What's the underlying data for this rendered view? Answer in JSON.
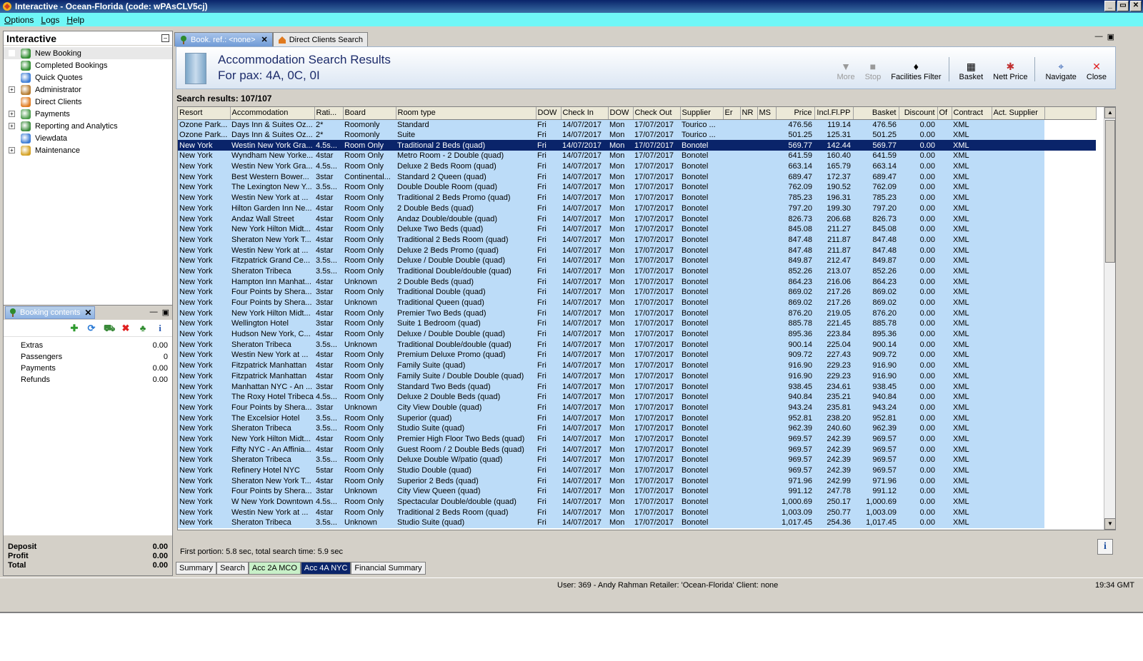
{
  "window": {
    "title": "Interactive - Ocean-Florida (code: wPAsCLV5cj)",
    "buttons": [
      "_",
      "▭",
      "✕"
    ]
  },
  "menu": [
    "Options",
    "Logs",
    "Help"
  ],
  "nav": {
    "title": "Interactive",
    "items": [
      {
        "label": "New Booking",
        "expander": "",
        "icon": "palm-tree-icon",
        "color": "#2e8b2e"
      },
      {
        "label": "Completed Bookings",
        "expander": "",
        "icon": "palm-tree-icon",
        "color": "#2e8b2e"
      },
      {
        "label": "Quick Quotes",
        "expander": "",
        "icon": "globe-icon",
        "color": "#3a7bd5"
      },
      {
        "label": "Administrator",
        "expander": "+",
        "icon": "person-icon",
        "color": "#b57a2e"
      },
      {
        "label": "Direct Clients",
        "expander": "",
        "icon": "house-icon",
        "color": "#e07a1e"
      },
      {
        "label": "Payments",
        "expander": "+",
        "icon": "payments-icon",
        "color": "#4a9a4a"
      },
      {
        "label": "Reporting and Analytics",
        "expander": "+",
        "icon": "report-icon",
        "color": "#3a8a3a"
      },
      {
        "label": "Viewdata",
        "expander": "",
        "icon": "globe-icon",
        "color": "#3a7bd5"
      },
      {
        "label": "Maintenance",
        "expander": "+",
        "icon": "toolbox-icon",
        "color": "#d4a020"
      }
    ]
  },
  "booking": {
    "tab_label": "Booking contents",
    "rows": [
      {
        "label": "Extras",
        "value": "0.00"
      },
      {
        "label": "Passengers",
        "value": "0"
      },
      {
        "label": "Payments",
        "value": "0.00"
      },
      {
        "label": "Refunds",
        "value": "0.00"
      }
    ],
    "totals": [
      {
        "label": "Deposit",
        "value": "0.00"
      },
      {
        "label": "Profit",
        "value": "0.00"
      },
      {
        "label": "Total",
        "value": "0.00"
      }
    ]
  },
  "tabs": [
    {
      "label": "Book. ref.: <none>",
      "active": true
    },
    {
      "label": "Direct Clients Search",
      "active": false
    }
  ],
  "search": {
    "title": "Accommodation Search Results",
    "subtitle": "For pax: 4A, 0C, 0I",
    "tools": [
      {
        "label": "More",
        "icon": "more-icon",
        "glyph": "▼",
        "disabled": true
      },
      {
        "label": "Stop",
        "icon": "stop-icon",
        "glyph": "■",
        "disabled": true
      },
      {
        "label": "Facilities Filter",
        "icon": "filter-icon",
        "glyph": "♦",
        "disabled": false
      },
      {
        "label": "Basket",
        "icon": "basket-icon",
        "glyph": "▦",
        "disabled": false
      },
      {
        "label": "Nett Price",
        "icon": "nett-price-icon",
        "glyph": "✱",
        "disabled": false
      },
      {
        "label": "Navigate",
        "icon": "navigate-icon",
        "glyph": "⌖",
        "disabled": false
      },
      {
        "label": "Close",
        "icon": "close-icon",
        "glyph": "✕",
        "disabled": false
      }
    ],
    "results_label": "Search results: 107/107",
    "timing": "First portion: 5.8 sec, total search time: 5.9 sec"
  },
  "table": {
    "columns": [
      "Resort",
      "Accommodation",
      "Rati...",
      "Board",
      "Room type",
      "DOW",
      "Check In",
      "DOW",
      "Check Out",
      "Supplier",
      "Er",
      "NR",
      "MS",
      "Price",
      "Incl.Fl.PP",
      "Basket",
      "Discount",
      "Of",
      "Contract",
      "Act. Supplier"
    ],
    "rows": [
      [
        "Ozone Park...",
        "Days Inn & Suites Oz...",
        "2*",
        "Roomonly",
        "Standard",
        "Fri",
        "14/07/2017",
        "Mon",
        "17/07/2017",
        "Tourico ...",
        "",
        "",
        "",
        "476.56",
        "119.14",
        "476.56",
        "0.00",
        "",
        "XML",
        ""
      ],
      [
        "Ozone Park...",
        "Days Inn & Suites Oz...",
        "2*",
        "Roomonly",
        "Suite",
        "Fri",
        "14/07/2017",
        "Mon",
        "17/07/2017",
        "Tourico ...",
        "",
        "",
        "",
        "501.25",
        "125.31",
        "501.25",
        "0.00",
        "",
        "XML",
        ""
      ],
      [
        "New York",
        "Westin New York Gra...",
        "4.5s...",
        "Room Only",
        "Traditional 2 Beds (quad)",
        "Fri",
        "14/07/2017",
        "Mon",
        "17/07/2017",
        "Bonotel",
        "",
        "",
        "",
        "569.77",
        "142.44",
        "569.77",
        "0.00",
        "",
        "XML",
        ""
      ],
      [
        "New York",
        "Wyndham New Yorke...",
        "4star",
        "Room Only",
        "Metro Room - 2 Double (quad)",
        "Fri",
        "14/07/2017",
        "Mon",
        "17/07/2017",
        "Bonotel",
        "",
        "",
        "",
        "641.59",
        "160.40",
        "641.59",
        "0.00",
        "",
        "XML",
        ""
      ],
      [
        "New York",
        "Westin New York Gra...",
        "4.5s...",
        "Room Only",
        "Deluxe 2 Beds Room (quad)",
        "Fri",
        "14/07/2017",
        "Mon",
        "17/07/2017",
        "Bonotel",
        "",
        "",
        "",
        "663.14",
        "165.79",
        "663.14",
        "0.00",
        "",
        "XML",
        ""
      ],
      [
        "New York",
        "Best Western Bower...",
        "3star",
        "Continental...",
        "Standard 2 Queen (quad)",
        "Fri",
        "14/07/2017",
        "Mon",
        "17/07/2017",
        "Bonotel",
        "",
        "",
        "",
        "689.47",
        "172.37",
        "689.47",
        "0.00",
        "",
        "XML",
        ""
      ],
      [
        "New York",
        "The Lexington New Y...",
        "3.5s...",
        "Room Only",
        "Double Double Room (quad)",
        "Fri",
        "14/07/2017",
        "Mon",
        "17/07/2017",
        "Bonotel",
        "",
        "",
        "",
        "762.09",
        "190.52",
        "762.09",
        "0.00",
        "",
        "XML",
        ""
      ],
      [
        "New York",
        "Westin New York at ...",
        "4star",
        "Room Only",
        "Traditional 2 Beds Promo (quad)",
        "Fri",
        "14/07/2017",
        "Mon",
        "17/07/2017",
        "Bonotel",
        "",
        "",
        "",
        "785.23",
        "196.31",
        "785.23",
        "0.00",
        "",
        "XML",
        ""
      ],
      [
        "New York",
        "Hilton Garden Inn Ne...",
        "4star",
        "Room Only",
        "2 Double Beds (quad)",
        "Fri",
        "14/07/2017",
        "Mon",
        "17/07/2017",
        "Bonotel",
        "",
        "",
        "",
        "797.20",
        "199.30",
        "797.20",
        "0.00",
        "",
        "XML",
        ""
      ],
      [
        "New York",
        "Andaz Wall Street",
        "4star",
        "Room Only",
        "Andaz Double/double (quad)",
        "Fri",
        "14/07/2017",
        "Mon",
        "17/07/2017",
        "Bonotel",
        "",
        "",
        "",
        "826.73",
        "206.68",
        "826.73",
        "0.00",
        "",
        "XML",
        ""
      ],
      [
        "New York",
        "New York Hilton Midt...",
        "4star",
        "Room Only",
        "Deluxe Two Beds (quad)",
        "Fri",
        "14/07/2017",
        "Mon",
        "17/07/2017",
        "Bonotel",
        "",
        "",
        "",
        "845.08",
        "211.27",
        "845.08",
        "0.00",
        "",
        "XML",
        ""
      ],
      [
        "New York",
        "Sheraton New York T...",
        "4star",
        "Room Only",
        "Traditional 2 Beds Room (quad)",
        "Fri",
        "14/07/2017",
        "Mon",
        "17/07/2017",
        "Bonotel",
        "",
        "",
        "",
        "847.48",
        "211.87",
        "847.48",
        "0.00",
        "",
        "XML",
        ""
      ],
      [
        "New York",
        "Westin New York at ...",
        "4star",
        "Room Only",
        "Deluxe 2 Beds Promo (quad)",
        "Fri",
        "14/07/2017",
        "Mon",
        "17/07/2017",
        "Bonotel",
        "",
        "",
        "",
        "847.48",
        "211.87",
        "847.48",
        "0.00",
        "",
        "XML",
        ""
      ],
      [
        "New York",
        "Fitzpatrick Grand Ce...",
        "3.5s...",
        "Room Only",
        "Deluxe / Double Double (quad)",
        "Fri",
        "14/07/2017",
        "Mon",
        "17/07/2017",
        "Bonotel",
        "",
        "",
        "",
        "849.87",
        "212.47",
        "849.87",
        "0.00",
        "",
        "XML",
        ""
      ],
      [
        "New York",
        "Sheraton Tribeca",
        "3.5s...",
        "Room Only",
        "Traditional Double/double (quad)",
        "Fri",
        "14/07/2017",
        "Mon",
        "17/07/2017",
        "Bonotel",
        "",
        "",
        "",
        "852.26",
        "213.07",
        "852.26",
        "0.00",
        "",
        "XML",
        ""
      ],
      [
        "New York",
        "Hampton Inn Manhat...",
        "4star",
        "Unknown",
        "2 Double Beds (quad)",
        "Fri",
        "14/07/2017",
        "Mon",
        "17/07/2017",
        "Bonotel",
        "",
        "",
        "",
        "864.23",
        "216.06",
        "864.23",
        "0.00",
        "",
        "XML",
        ""
      ],
      [
        "New York",
        "Four Points by Shera...",
        "3star",
        "Room Only",
        "Traditional Double (quad)",
        "Fri",
        "14/07/2017",
        "Mon",
        "17/07/2017",
        "Bonotel",
        "",
        "",
        "",
        "869.02",
        "217.26",
        "869.02",
        "0.00",
        "",
        "XML",
        ""
      ],
      [
        "New York",
        "Four Points by Shera...",
        "3star",
        "Unknown",
        "Traditional Queen (quad)",
        "Fri",
        "14/07/2017",
        "Mon",
        "17/07/2017",
        "Bonotel",
        "",
        "",
        "",
        "869.02",
        "217.26",
        "869.02",
        "0.00",
        "",
        "XML",
        ""
      ],
      [
        "New York",
        "New York Hilton Midt...",
        "4star",
        "Room Only",
        "Premier Two Beds (quad)",
        "Fri",
        "14/07/2017",
        "Mon",
        "17/07/2017",
        "Bonotel",
        "",
        "",
        "",
        "876.20",
        "219.05",
        "876.20",
        "0.00",
        "",
        "XML",
        ""
      ],
      [
        "New York",
        "Wellington Hotel",
        "3star",
        "Room Only",
        "Suite 1 Bedroom (quad)",
        "Fri",
        "14/07/2017",
        "Mon",
        "17/07/2017",
        "Bonotel",
        "",
        "",
        "",
        "885.78",
        "221.45",
        "885.78",
        "0.00",
        "",
        "XML",
        ""
      ],
      [
        "New York",
        "Hudson New York, C...",
        "4star",
        "Room Only",
        "Deluxe / Double Double (quad)",
        "Fri",
        "14/07/2017",
        "Mon",
        "17/07/2017",
        "Bonotel",
        "",
        "",
        "",
        "895.36",
        "223.84",
        "895.36",
        "0.00",
        "",
        "XML",
        ""
      ],
      [
        "New York",
        "Sheraton Tribeca",
        "3.5s...",
        "Unknown",
        "Traditional Double/double (quad)",
        "Fri",
        "14/07/2017",
        "Mon",
        "17/07/2017",
        "Bonotel",
        "",
        "",
        "",
        "900.14",
        "225.04",
        "900.14",
        "0.00",
        "",
        "XML",
        ""
      ],
      [
        "New York",
        "Westin New York at ...",
        "4star",
        "Room Only",
        "Premium Deluxe Promo (quad)",
        "Fri",
        "14/07/2017",
        "Mon",
        "17/07/2017",
        "Bonotel",
        "",
        "",
        "",
        "909.72",
        "227.43",
        "909.72",
        "0.00",
        "",
        "XML",
        ""
      ],
      [
        "New York",
        "Fitzpatrick Manhattan",
        "4star",
        "Room Only",
        "Family Suite (quad)",
        "Fri",
        "14/07/2017",
        "Mon",
        "17/07/2017",
        "Bonotel",
        "",
        "",
        "",
        "916.90",
        "229.23",
        "916.90",
        "0.00",
        "",
        "XML",
        ""
      ],
      [
        "New York",
        "Fitzpatrick Manhattan",
        "4star",
        "Room Only",
        "Family Suite / Double Double (quad)",
        "Fri",
        "14/07/2017",
        "Mon",
        "17/07/2017",
        "Bonotel",
        "",
        "",
        "",
        "916.90",
        "229.23",
        "916.90",
        "0.00",
        "",
        "XML",
        ""
      ],
      [
        "New York",
        "Manhattan NYC - An ...",
        "3star",
        "Room Only",
        "Standard Two Beds (quad)",
        "Fri",
        "14/07/2017",
        "Mon",
        "17/07/2017",
        "Bonotel",
        "",
        "",
        "",
        "938.45",
        "234.61",
        "938.45",
        "0.00",
        "",
        "XML",
        ""
      ],
      [
        "New York",
        "The Roxy Hotel Tribeca",
        "4.5s...",
        "Room Only",
        "Deluxe 2 Double Beds (quad)",
        "Fri",
        "14/07/2017",
        "Mon",
        "17/07/2017",
        "Bonotel",
        "",
        "",
        "",
        "940.84",
        "235.21",
        "940.84",
        "0.00",
        "",
        "XML",
        ""
      ],
      [
        "New York",
        "Four Points by Shera...",
        "3star",
        "Unknown",
        "City View Double (quad)",
        "Fri",
        "14/07/2017",
        "Mon",
        "17/07/2017",
        "Bonotel",
        "",
        "",
        "",
        "943.24",
        "235.81",
        "943.24",
        "0.00",
        "",
        "XML",
        ""
      ],
      [
        "New York",
        "The Excelsior Hotel",
        "3.5s...",
        "Room Only",
        "Superior (quad)",
        "Fri",
        "14/07/2017",
        "Mon",
        "17/07/2017",
        "Bonotel",
        "",
        "",
        "",
        "952.81",
        "238.20",
        "952.81",
        "0.00",
        "",
        "XML",
        ""
      ],
      [
        "New York",
        "Sheraton Tribeca",
        "3.5s...",
        "Room Only",
        "Studio Suite (quad)",
        "Fri",
        "14/07/2017",
        "Mon",
        "17/07/2017",
        "Bonotel",
        "",
        "",
        "",
        "962.39",
        "240.60",
        "962.39",
        "0.00",
        "",
        "XML",
        ""
      ],
      [
        "New York",
        "New York Hilton Midt...",
        "4star",
        "Room Only",
        "Premier High Floor Two Beds (quad)",
        "Fri",
        "14/07/2017",
        "Mon",
        "17/07/2017",
        "Bonotel",
        "",
        "",
        "",
        "969.57",
        "242.39",
        "969.57",
        "0.00",
        "",
        "XML",
        ""
      ],
      [
        "New York",
        "Fifty NYC - An Affinia...",
        "4star",
        "Room Only",
        "Guest Room / 2 Double Beds (quad)",
        "Fri",
        "14/07/2017",
        "Mon",
        "17/07/2017",
        "Bonotel",
        "",
        "",
        "",
        "969.57",
        "242.39",
        "969.57",
        "0.00",
        "",
        "XML",
        ""
      ],
      [
        "New York",
        "Sheraton Tribeca",
        "3.5s...",
        "Room Only",
        "Deluxe Double W/patio (quad)",
        "Fri",
        "14/07/2017",
        "Mon",
        "17/07/2017",
        "Bonotel",
        "",
        "",
        "",
        "969.57",
        "242.39",
        "969.57",
        "0.00",
        "",
        "XML",
        ""
      ],
      [
        "New York",
        "Refinery Hotel NYC",
        "5star",
        "Room Only",
        "Studio Double (quad)",
        "Fri",
        "14/07/2017",
        "Mon",
        "17/07/2017",
        "Bonotel",
        "",
        "",
        "",
        "969.57",
        "242.39",
        "969.57",
        "0.00",
        "",
        "XML",
        ""
      ],
      [
        "New York",
        "Sheraton New York T...",
        "4star",
        "Room Only",
        "Superior 2 Beds (quad)",
        "Fri",
        "14/07/2017",
        "Mon",
        "17/07/2017",
        "Bonotel",
        "",
        "",
        "",
        "971.96",
        "242.99",
        "971.96",
        "0.00",
        "",
        "XML",
        ""
      ],
      [
        "New York",
        "Four Points by Shera...",
        "3star",
        "Unknown",
        "City View Queen (quad)",
        "Fri",
        "14/07/2017",
        "Mon",
        "17/07/2017",
        "Bonotel",
        "",
        "",
        "",
        "991.12",
        "247.78",
        "991.12",
        "0.00",
        "",
        "XML",
        ""
      ],
      [
        "New York",
        "W New York Downtown",
        "4.5s...",
        "Room Only",
        "Spectacular Double/double (quad)",
        "Fri",
        "14/07/2017",
        "Mon",
        "17/07/2017",
        "Bonotel",
        "",
        "",
        "",
        "1,000.69",
        "250.17",
        "1,000.69",
        "0.00",
        "",
        "XML",
        ""
      ],
      [
        "New York",
        "Westin New York at ...",
        "4star",
        "Room Only",
        "Traditional 2 Beds Room (quad)",
        "Fri",
        "14/07/2017",
        "Mon",
        "17/07/2017",
        "Bonotel",
        "",
        "",
        "",
        "1,003.09",
        "250.77",
        "1,003.09",
        "0.00",
        "",
        "XML",
        ""
      ],
      [
        "New York",
        "Sheraton Tribeca",
        "3.5s...",
        "Unknown",
        "Studio Suite (quad)",
        "Fri",
        "14/07/2017",
        "Mon",
        "17/07/2017",
        "Bonotel",
        "",
        "",
        "",
        "1,017.45",
        "254.36",
        "1,017.45",
        "0.00",
        "",
        "XML",
        ""
      ]
    ],
    "selected_row": 2
  },
  "bottom_tabs": [
    {
      "label": "Summary",
      "style": "plain"
    },
    {
      "label": "Search",
      "style": "plain"
    },
    {
      "label": "Acc 2A MCO",
      "style": "green"
    },
    {
      "label": "Acc 4A NYC",
      "style": "active"
    },
    {
      "label": "Financial Summary",
      "style": "plain"
    }
  ],
  "status": {
    "user": "User: 369 - Andy Rahman   Retailer: 'Ocean-Florida'   Client: none",
    "time": "19:34 GMT"
  },
  "colors": {
    "row_bg": "#bcdcf8",
    "selected_bg": "#0a246a",
    "menubar_bg": "#6ff7f7",
    "header_text": "#1d2c6b"
  }
}
